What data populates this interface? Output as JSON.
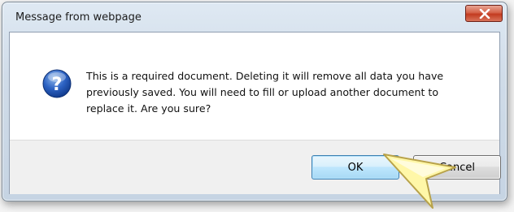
{
  "dialog": {
    "title": "Message from webpage",
    "close_icon": "close-x-icon",
    "icon": "question-icon",
    "message_lines": [
      "This is a required document.  Deleting it will remove all data you have",
      "previously saved.  You will need to fill or upload another document to",
      "replace it.  Are you sure?"
    ],
    "ok_label": "OK",
    "cancel_label": "Cancel"
  },
  "overlay": {
    "pointer_icon": "pointer-arrow-icon",
    "pointer_color": "#fff7a8"
  }
}
